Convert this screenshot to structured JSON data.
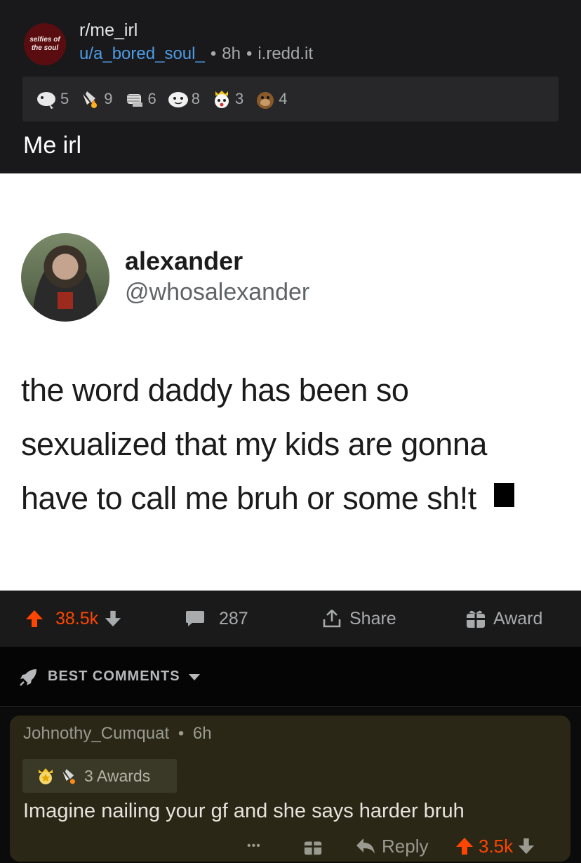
{
  "post": {
    "subreddit_logo_text": "selfies of the soul",
    "subreddit": "r/me_irl",
    "user": "u/a_bored_soul_",
    "age": "8h",
    "domain": "i.redd.it",
    "title": "Me irl",
    "awards": [
      {
        "icon": "wholesome-seal-icon",
        "count": "5"
      },
      {
        "icon": "rocket-like-icon",
        "count": "9"
      },
      {
        "icon": "respect-fist-icon",
        "count": "6"
      },
      {
        "icon": "face-award-icon",
        "count": "8"
      },
      {
        "icon": "surprised-crown-icon",
        "count": "3"
      },
      {
        "icon": "dog-award-icon",
        "count": "4"
      }
    ]
  },
  "tweet": {
    "name": "alexander",
    "handle": "@whosalexander",
    "line1": "the word daddy has been so",
    "line2": "sexualized that my kids are gonna",
    "line3": "have to call me bruh or some sh!t"
  },
  "actions": {
    "score": "38.5k",
    "comments": "287",
    "share": "Share",
    "award": "Award"
  },
  "sort": {
    "label": "BEST COMMENTS"
  },
  "comment": {
    "author": "Johnothy_Cumquat",
    "age": "6h",
    "awards_text": "3 Awards",
    "body": "Imagine nailing your gf and she says harder bruh",
    "more": "•••",
    "reply": "Reply",
    "score": "3.5k"
  },
  "colors": {
    "accent_upvote": "#ff4500",
    "link_blue": "#4e9be6",
    "header_bg": "#19191b",
    "comment_bg": "#2a2716"
  }
}
